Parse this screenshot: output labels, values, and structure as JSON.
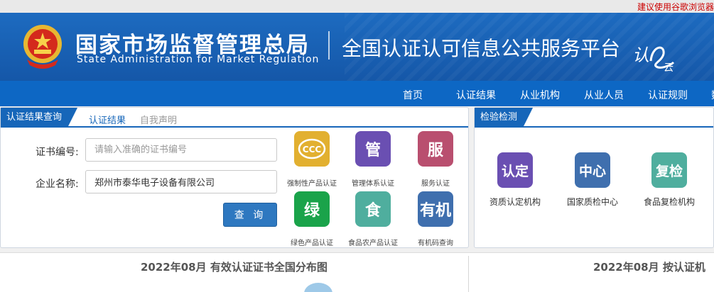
{
  "browser_tip": "建议使用谷歌浏览器",
  "header": {
    "agency_cn": "国家市场监督管理总局",
    "agency_en": "State Administration  for  Market Regulation",
    "platform_title": "全国认证认可信息公共服务平台",
    "logo_text_1": "认",
    "logo_text_2": "云"
  },
  "nav": {
    "items": [
      "首页",
      "认证结果",
      "从业机构",
      "从业人员",
      "认证规则",
      "数"
    ]
  },
  "cert_panel": {
    "tab_primary": "认证结果查询",
    "tab_active": "认证结果",
    "tab_other": "自我声明",
    "cert_no_label": "证书编号:",
    "cert_no_placeholder": "请输入准确的证书编号",
    "company_label": "企业名称:",
    "company_value": "郑州市泰华电子设备有限公司",
    "query_button": "查 询",
    "tiles": [
      {
        "glyph": "CCC",
        "label": "强制性产品认证",
        "color": "#e2b030"
      },
      {
        "glyph": "管",
        "label": "管理体系认证",
        "color": "#6a4fb2"
      },
      {
        "glyph": "服",
        "label": "服务认证",
        "color": "#b94f6f"
      },
      {
        "glyph": "绿",
        "label": "绿色产品认证",
        "color": "#1aa34a"
      },
      {
        "glyph": "食",
        "label": "食品农产品认证",
        "color": "#4fae9e"
      },
      {
        "glyph": "有机",
        "label": "有机码查询",
        "color": "#3f6fae"
      }
    ]
  },
  "inspection_panel": {
    "tab_primary": "检验检测",
    "tiles": [
      {
        "glyph": "认定",
        "label": "资质认定机构",
        "color": "#6a4fb2"
      },
      {
        "glyph": "中心",
        "label": "国家质检中心",
        "color": "#3f6fae"
      },
      {
        "glyph": "复检",
        "label": "食品复检机构",
        "color": "#4fae9e"
      }
    ]
  },
  "bottom": {
    "left_title": "2022年08月  有效认证证书全国分布图",
    "right_title": "2022年08月   按认证机"
  }
}
